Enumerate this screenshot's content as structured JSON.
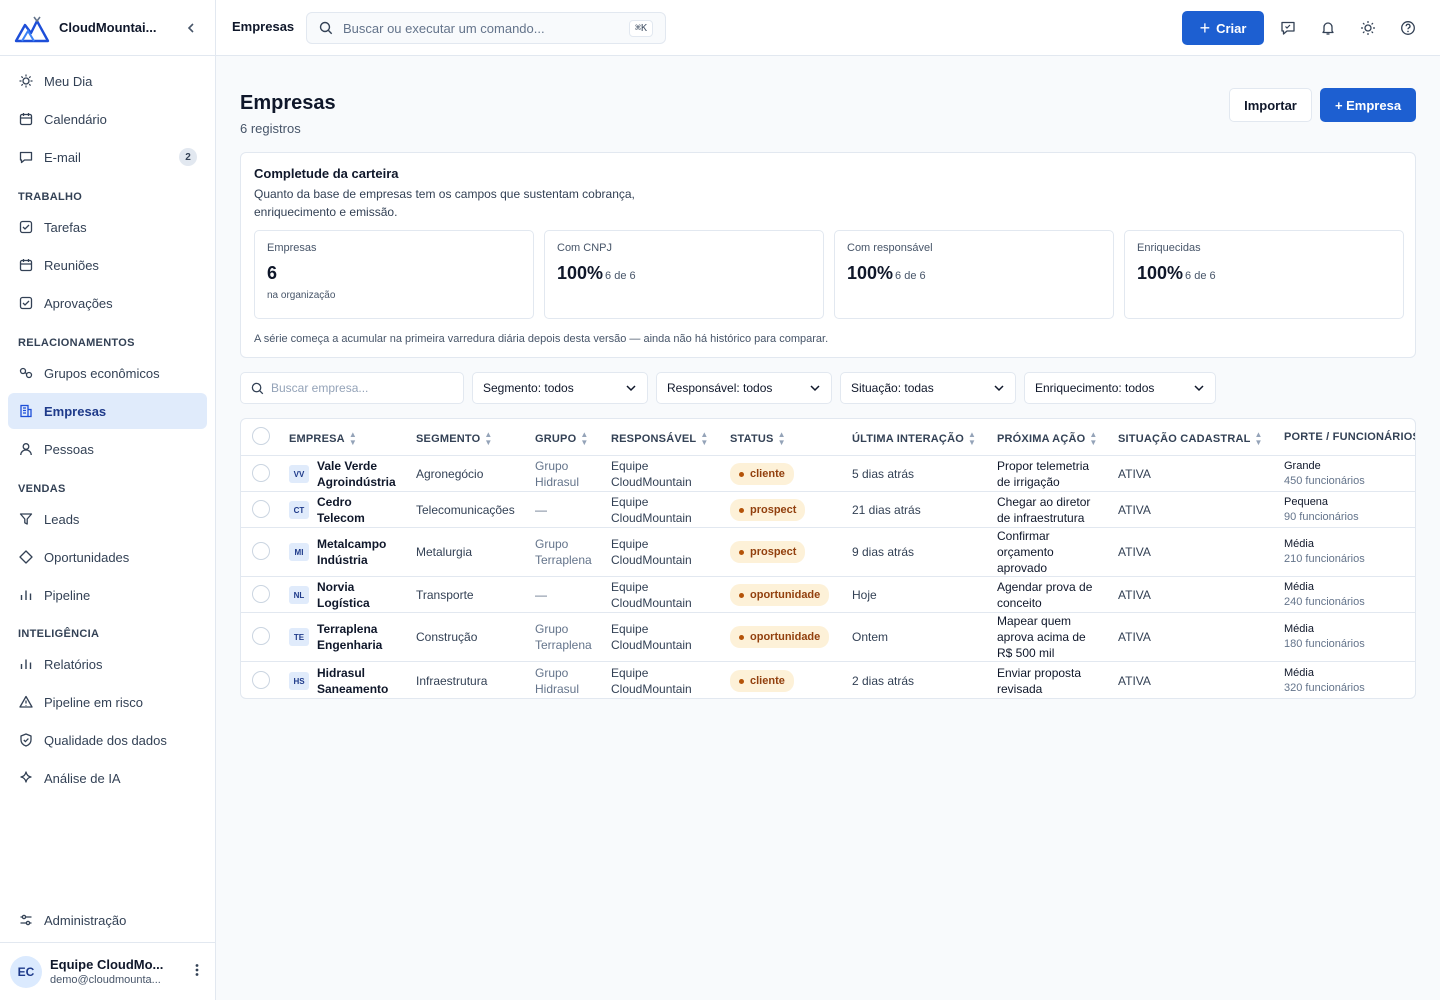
{
  "app": {
    "name": "CloudMountai..."
  },
  "sidebar": {
    "items_top": [
      {
        "label": "Meu Dia",
        "icon": "sun-icon"
      },
      {
        "label": "Calendário",
        "icon": "calendar-icon"
      },
      {
        "label": "E-mail",
        "icon": "message-icon",
        "badge": "2"
      }
    ],
    "sections": {
      "work": "TRABALHO",
      "rel": "RELACIONAMENTOS",
      "sales": "VENDAS",
      "intel": "INTELIGÊNCIA"
    },
    "work_items": [
      {
        "label": "Tarefas",
        "icon": "checkbox-icon"
      },
      {
        "label": "Reuniões",
        "icon": "calendar-icon"
      },
      {
        "label": "Aprovações",
        "icon": "checkbox-icon"
      }
    ],
    "rel_items": [
      {
        "label": "Grupos econômicos",
        "icon": "link-icon"
      },
      {
        "label": "Empresas",
        "icon": "building-icon"
      },
      {
        "label": "Pessoas",
        "icon": "user-icon"
      }
    ],
    "sales_items": [
      {
        "label": "Leads",
        "icon": "filter-icon"
      },
      {
        "label": "Oportunidades",
        "icon": "diamond-icon"
      },
      {
        "label": "Pipeline",
        "icon": "bar-chart-icon"
      }
    ],
    "intel_items": [
      {
        "label": "Relatórios",
        "icon": "bar-chart-icon"
      },
      {
        "label": "Pipeline em risco",
        "icon": "warning-icon"
      },
      {
        "label": "Qualidade dos dados",
        "icon": "shield-icon"
      },
      {
        "label": "Análise de IA",
        "icon": "sparkle-icon"
      }
    ],
    "admin": {
      "label": "Administração",
      "icon": "sliders-icon"
    },
    "user": {
      "initials": "EC",
      "name": "Equipe CloudMo...",
      "email": "demo@cloudmounta..."
    }
  },
  "topbar": {
    "breadcrumb": "Empresas",
    "search_placeholder": "Buscar ou executar um comando...",
    "shortcut": "⌘K",
    "create_label": "Criar"
  },
  "page": {
    "title": "Empresas",
    "subtitle": "6 registros",
    "import_label": "Importar",
    "add_label": "+ Empresa"
  },
  "completeness": {
    "title": "Completude da carteira",
    "description": "Quanto da base de empresas tem os campos que sustentam cobrança, enriquecimento e emissão.",
    "kpis": [
      {
        "label": "Empresas",
        "value": "6",
        "sub": "",
        "foot": "na organização"
      },
      {
        "label": "Com CNPJ",
        "value": "100%",
        "sub": "6 de 6",
        "foot": ""
      },
      {
        "label": "Com responsável",
        "value": "100%",
        "sub": "6 de 6",
        "foot": ""
      },
      {
        "label": "Enriquecidas",
        "value": "100%",
        "sub": "6 de 6",
        "foot": ""
      }
    ],
    "note": "A série começa a acumular na primeira varredura diária depois desta versão — ainda não há histórico para comparar."
  },
  "filters": {
    "search_placeholder": "Buscar empresa...",
    "segment": "Segmento: todos",
    "owner": "Responsável: todos",
    "status": "Situação: todas",
    "enrichment": "Enriquecimento: todos"
  },
  "table": {
    "headers": [
      "EMPRESA",
      "SEGMENTO",
      "GRUPO",
      "RESPONSÁVEL",
      "STATUS",
      "ÚLTIMA INTERAÇÃO",
      "PRÓXIMA AÇÃO",
      "SITUAÇÃO CADASTRAL",
      "PORTE / FUNCIONÁRIOS"
    ],
    "rows": [
      {
        "initials": "VV",
        "name": "Vale Verde Agroindústria",
        "segment": "Agronegócio",
        "group": "Grupo Hidrasul",
        "owner": "Equipe CloudMountain",
        "status": "cliente",
        "last": "5 dias atrás",
        "next": "Propor telemetria de irrigação",
        "reg": "ATIVA",
        "size": "Grande",
        "employees": "450 funcionários"
      },
      {
        "initials": "CT",
        "name": "Cedro Telecom",
        "segment": "Telecomunicações",
        "group": "—",
        "owner": "Equipe CloudMountain",
        "status": "prospect",
        "last": "21 dias atrás",
        "next": "Chegar ao diretor de infraestrutura",
        "reg": "ATIVA",
        "size": "Pequena",
        "employees": "90 funcionários"
      },
      {
        "initials": "MI",
        "name": "Metalcampo Indústria",
        "segment": "Metalurgia",
        "group": "Grupo Terraplena",
        "owner": "Equipe CloudMountain",
        "status": "prospect",
        "last": "9 dias atrás",
        "next": "Confirmar orçamento aprovado",
        "reg": "ATIVA",
        "size": "Média",
        "employees": "210 funcionários"
      },
      {
        "initials": "NL",
        "name": "Norvia Logística",
        "segment": "Transporte",
        "group": "—",
        "owner": "Equipe CloudMountain",
        "status": "oportunidade",
        "last": "Hoje",
        "next": "Agendar prova de conceito",
        "reg": "ATIVA",
        "size": "Média",
        "employees": "240 funcionários"
      },
      {
        "initials": "TE",
        "name": "Terraplena Engenharia",
        "segment": "Construção",
        "group": "Grupo Terraplena",
        "owner": "Equipe CloudMountain",
        "status": "oportunidade",
        "last": "Ontem",
        "next": "Mapear quem aprova acima de R$ 500 mil",
        "reg": "ATIVA",
        "size": "Média",
        "employees": "180 funcionários"
      },
      {
        "initials": "HS",
        "name": "Hidrasul Saneamento",
        "segment": "Infraestrutura",
        "group": "Grupo Hidrasul",
        "owner": "Equipe CloudMountain",
        "status": "cliente",
        "last": "2 dias atrás",
        "next": "Enviar proposta revisada",
        "reg": "ATIVA",
        "size": "Média",
        "employees": "320 funcionários"
      }
    ]
  },
  "colors": {
    "accent": "#1d5fd1",
    "active_bg": "#e0ebfb",
    "pill_bg": "#fdf1d8",
    "pill_text": "#92400e"
  }
}
